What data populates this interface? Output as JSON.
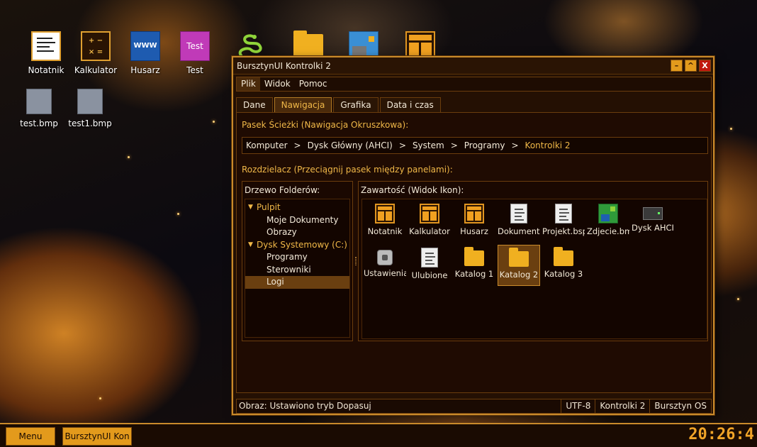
{
  "desktop": {
    "icons": [
      {
        "label": "Notatnik"
      },
      {
        "label": "Kalkulator"
      },
      {
        "label": "Husarz",
        "glyph": "WWW"
      },
      {
        "label": "Test",
        "glyph": "Test"
      },
      {
        "label": "test.bmp"
      },
      {
        "label": "test1.bmp"
      }
    ]
  },
  "window": {
    "title": "BursztynUI Kontrolki 2",
    "controls": {
      "minimize": "–",
      "maximize": "^",
      "close": "X"
    },
    "menu": [
      "Plik",
      "Widok",
      "Pomoc"
    ],
    "tabs": [
      "Dane",
      "Nawigacja",
      "Grafika",
      "Data i czas"
    ],
    "active_tab": "Nawigacja",
    "breadcrumb_label": "Pasek Ścieżki (Nawigacja Okruszkowa):",
    "breadcrumb": [
      "Komputer",
      "Dysk Główny (AHCI)",
      "System",
      "Programy",
      "Kontrolki 2"
    ],
    "breadcrumb_separator": ">",
    "splitter_label": "Rozdzielacz (Przeciągnij pasek między panelami):",
    "tree_title": "Drzewo Folderów:",
    "tree": [
      {
        "label": "Pulpit",
        "level": 0,
        "expanded": true
      },
      {
        "label": "Moje Dokumenty",
        "level": 1
      },
      {
        "label": "Obrazy",
        "level": 1
      },
      {
        "label": "Dysk Systemowy (C:)",
        "level": 0,
        "expanded": true
      },
      {
        "label": "Programy",
        "level": 1
      },
      {
        "label": "Sterowniki",
        "level": 1
      },
      {
        "label": "Logi",
        "level": 1,
        "selected": true
      }
    ],
    "content_title": "Zawartość (Widok Ikon):",
    "files": [
      {
        "label": "Notatnik",
        "icon": "app-icon"
      },
      {
        "label": "Kalkulator",
        "icon": "app-icon"
      },
      {
        "label": "Husarz",
        "icon": "app-icon"
      },
      {
        "label": "Dokument.t",
        "icon": "document-icon"
      },
      {
        "label": "Projekt.bsp",
        "icon": "document-icon"
      },
      {
        "label": "Zdjecie.bm",
        "icon": "image-icon"
      },
      {
        "label": "Dysk AHCI",
        "icon": "disk-icon"
      },
      {
        "label": "Ustawienia",
        "icon": "settings-icon"
      },
      {
        "label": "Ulubione",
        "icon": "document-icon"
      },
      {
        "label": "Katalog 1",
        "icon": "folder-icon"
      },
      {
        "label": "Katalog 2",
        "icon": "folder-icon",
        "selected": true
      },
      {
        "label": "Katalog 3",
        "icon": "folder-icon"
      }
    ],
    "status": {
      "message": "Obraz: Ustawiono tryb Dopasuj",
      "encoding": "UTF-8",
      "app": "Kontrolki 2",
      "os": "Bursztyn OS"
    }
  },
  "taskbar": {
    "menu_label": "Menu",
    "task_label": "BursztynUI Kon",
    "clock": "20:26:4"
  },
  "colors": {
    "accent": "#f0b848",
    "border": "#c98a2b",
    "button": "#e39a1c",
    "close": "#c0180e"
  }
}
